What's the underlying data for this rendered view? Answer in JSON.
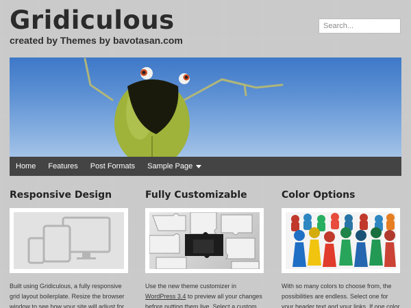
{
  "header": {
    "site_title": "Gridiculous",
    "site_description": "created by Themes by bavotasan.com",
    "search_placeholder": "Search..."
  },
  "nav": {
    "items": [
      {
        "label": "Home"
      },
      {
        "label": "Features"
      },
      {
        "label": "Post Formats"
      },
      {
        "label": "Sample Page",
        "has_dropdown": true
      }
    ]
  },
  "columns": [
    {
      "title": "Responsive Design",
      "text": "Built using Gridiculous, a fully responsive grid layout boilerplate. Resize the browser window to see how your site will adjust for"
    },
    {
      "title": "Fully Customizable",
      "text_before_link": "Use the new theme customizer in ",
      "link": "WordPress 3.4",
      "text_after_link": " to preview all your changes before putting them live. Select a custom"
    },
    {
      "title": "Color Options",
      "text": "With so many colors to choose from, the possibilities are endless. Select one for your header text and your links. If one color isn't"
    }
  ],
  "colors": {
    "background": "#c9c9c9",
    "nav_background": "#444444",
    "sky_top": "#3e78c8",
    "sky_bottom": "#a4c3e8",
    "creature_green": "#9fb23a"
  }
}
